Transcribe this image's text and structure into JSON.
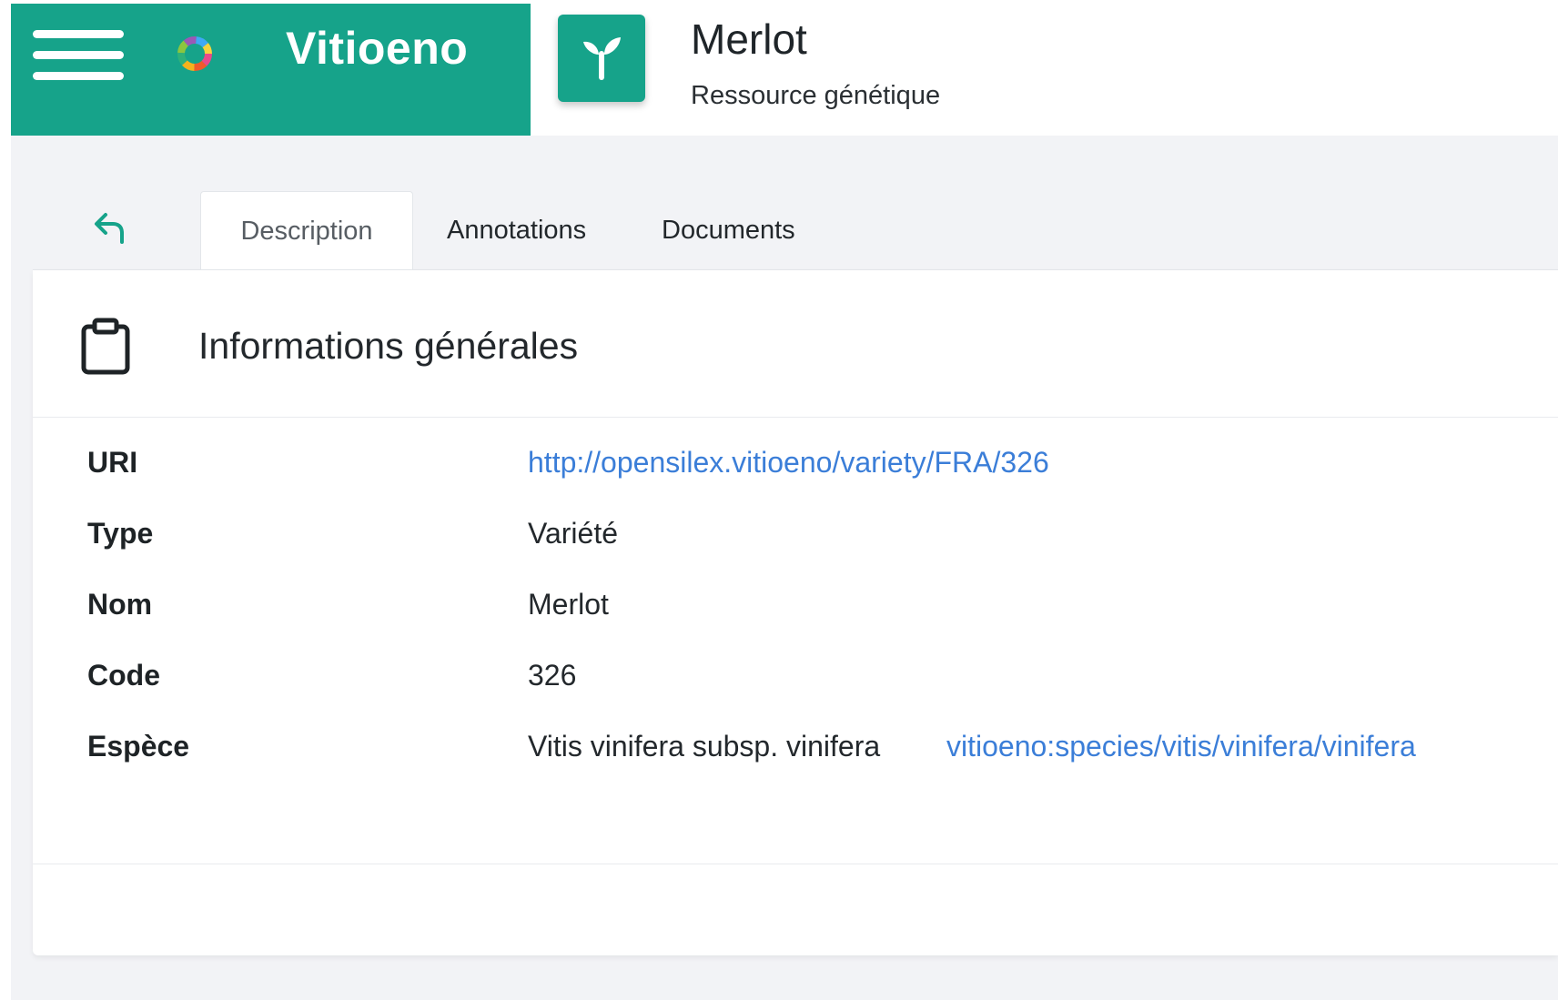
{
  "brand": {
    "name": "Vitioeno"
  },
  "icons": {
    "menu": "hamburger-menu-icon",
    "logo": "opensilex-logo-icon",
    "page": "seedling-icon",
    "back": "back-arrow-icon",
    "section": "clipboard-icon"
  },
  "colors": {
    "accent": "#16a38a",
    "link": "#3b7ed8"
  },
  "page": {
    "title": "Merlot",
    "subtitle": "Ressource génétique"
  },
  "tabs": [
    {
      "label": "Description",
      "active": true
    },
    {
      "label": "Annotations",
      "active": false
    },
    {
      "label": "Documents",
      "active": false
    }
  ],
  "section": {
    "title": "Informations générales"
  },
  "fields": {
    "uri": {
      "label": "URI",
      "value": "http://opensilex.vitioeno/variety/FRA/326"
    },
    "type": {
      "label": "Type",
      "value": "Variété"
    },
    "nom": {
      "label": "Nom",
      "value": "Merlot"
    },
    "code": {
      "label": "Code",
      "value": "326"
    },
    "espece": {
      "label": "Espèce",
      "value": "Vitis vinifera subsp. vinifera",
      "link": "vitioeno:species/vitis/vinifera/vinifera"
    }
  }
}
